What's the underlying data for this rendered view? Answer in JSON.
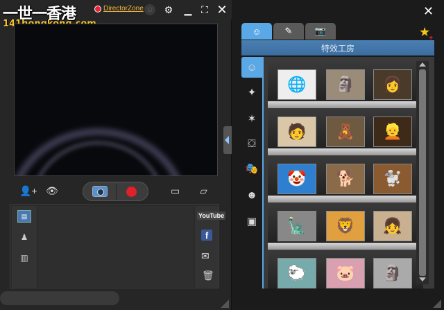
{
  "watermark": {
    "title": "一世一香港",
    "subtitle": "141hongkong.com"
  },
  "titlebar": {
    "director_zone": "DirectorZone"
  },
  "right_panel": {
    "studio_title": "特效工房"
  },
  "bottom_panel": {
    "youtube_label": "YouTube",
    "facebook_label": "f"
  },
  "icons": {
    "gear": "⚙",
    "minimize": "▁",
    "maximize": "⛶",
    "close": "✕",
    "add_user": "👤+",
    "eye": "👁",
    "monitor": "▭",
    "eraser": "▱",
    "person": "♟",
    "filmstrip": "▥",
    "mail": "✉",
    "trash": "🗑",
    "magic": "✦",
    "splash": "✶",
    "frame": "⛋",
    "mask": "🎭",
    "smile": "☻",
    "screen": "▣",
    "face": "☺",
    "pencil": "✎",
    "camera": "📷",
    "star": "★",
    "film_tab": "▤"
  },
  "thumbnails": [
    [
      "🌐",
      "🗿",
      "👩"
    ],
    [
      "🧑",
      "🧸",
      "👱"
    ],
    [
      "🤡",
      "🐕",
      "🐩"
    ],
    [
      "🗽",
      "🦁",
      "👧"
    ],
    [
      "🐑",
      "🐷",
      "🗿"
    ]
  ],
  "colors": {
    "accent": "#5aa9e6",
    "record": "#e0202a",
    "dz": "#f4b942"
  }
}
